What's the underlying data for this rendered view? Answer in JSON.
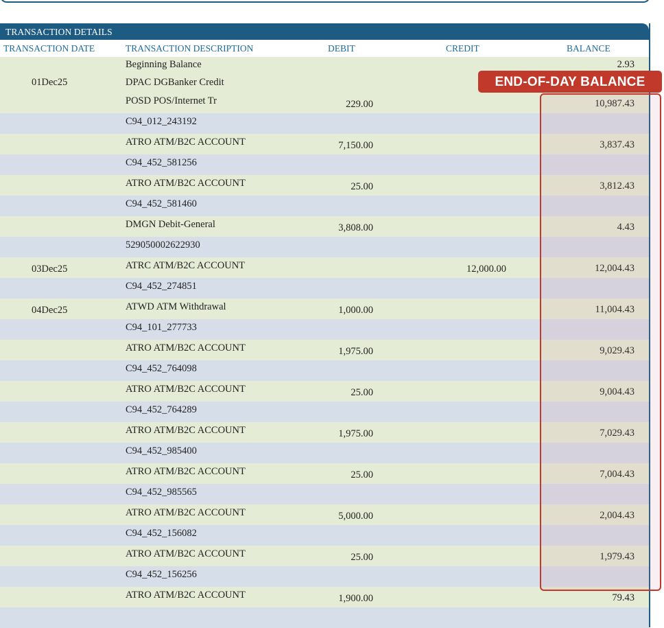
{
  "section_title": "TRANSACTION DETAILS",
  "columns": {
    "date": "TRANSACTION DATE",
    "description": "TRANSACTION DESCRIPTION",
    "debit": "DEBIT",
    "credit": "CREDIT",
    "balance": "BALANCE"
  },
  "annotation": {
    "label": "END-OF-DAY BALANCE",
    "color": "#c0392b"
  },
  "colors": {
    "header_bg": "#1d5b82",
    "heading_text": "#1e6a9c",
    "row_green": "#e4ecd6",
    "row_blue": "#d6dfe9"
  },
  "rows": [
    {
      "date": "",
      "description": "Beginning Balance",
      "debit": "",
      "credit": "",
      "balance": "2.93"
    },
    {
      "date": "01Dec25",
      "description": "DPAC DGBanker Credit",
      "debit": "",
      "credit": "",
      "balance": ""
    },
    {
      "date": "",
      "description": "POSD POS/Internet Tr",
      "debit": "229.00",
      "credit": "",
      "balance": "10,987.43"
    },
    {
      "date": "",
      "description": "C94_012_243192",
      "debit": "",
      "credit": "",
      "balance": ""
    },
    {
      "date": "",
      "description": "ATRO ATM/B2C ACCOUNT",
      "debit": "7,150.00",
      "credit": "",
      "balance": "3,837.43"
    },
    {
      "date": "",
      "description": "C94_452_581256",
      "debit": "",
      "credit": "",
      "balance": ""
    },
    {
      "date": "",
      "description": "ATRO ATM/B2C ACCOUNT",
      "debit": "25.00",
      "credit": "",
      "balance": "3,812.43"
    },
    {
      "date": "",
      "description": "C94_452_581460",
      "debit": "",
      "credit": "",
      "balance": ""
    },
    {
      "date": "",
      "description": "DMGN Debit-General",
      "debit": "3,808.00",
      "credit": "",
      "balance": "4.43"
    },
    {
      "date": "",
      "description": "529050002622930",
      "debit": "",
      "credit": "",
      "balance": ""
    },
    {
      "date": "03Dec25",
      "description": "ATRC ATM/B2C ACCOUNT",
      "debit": "",
      "credit": "12,000.00",
      "balance": "12,004.43"
    },
    {
      "date": "",
      "description": "C94_452_274851",
      "debit": "",
      "credit": "",
      "balance": ""
    },
    {
      "date": "04Dec25",
      "description": "ATWD ATM Withdrawal",
      "debit": "1,000.00",
      "credit": "",
      "balance": "11,004.43"
    },
    {
      "date": "",
      "description": "C94_101_277733",
      "debit": "",
      "credit": "",
      "balance": ""
    },
    {
      "date": "",
      "description": "ATRO ATM/B2C ACCOUNT",
      "debit": "1,975.00",
      "credit": "",
      "balance": "9,029.43"
    },
    {
      "date": "",
      "description": "C94_452_764098",
      "debit": "",
      "credit": "",
      "balance": ""
    },
    {
      "date": "",
      "description": "ATRO ATM/B2C ACCOUNT",
      "debit": "25.00",
      "credit": "",
      "balance": "9,004.43"
    },
    {
      "date": "",
      "description": "C94_452_764289",
      "debit": "",
      "credit": "",
      "balance": ""
    },
    {
      "date": "",
      "description": "ATRO ATM/B2C ACCOUNT",
      "debit": "1,975.00",
      "credit": "",
      "balance": "7,029.43"
    },
    {
      "date": "",
      "description": "C94_452_985400",
      "debit": "",
      "credit": "",
      "balance": ""
    },
    {
      "date": "",
      "description": "ATRO ATM/B2C ACCOUNT",
      "debit": "25.00",
      "credit": "",
      "balance": "7,004.43"
    },
    {
      "date": "",
      "description": "C94_452_985565",
      "debit": "",
      "credit": "",
      "balance": ""
    },
    {
      "date": "",
      "description": "ATRO ATM/B2C ACCOUNT",
      "debit": "5,000.00",
      "credit": "",
      "balance": "2,004.43"
    },
    {
      "date": "",
      "description": "C94_452_156082",
      "debit": "",
      "credit": "",
      "balance": ""
    },
    {
      "date": "",
      "description": "ATRO ATM/B2C ACCOUNT",
      "debit": "25.00",
      "credit": "",
      "balance": "1,979.43"
    },
    {
      "date": "",
      "description": "C94_452_156256",
      "debit": "",
      "credit": "",
      "balance": ""
    },
    {
      "date": "",
      "description": "ATRO ATM/B2C ACCOUNT",
      "debit": "1,900.00",
      "credit": "",
      "balance": "79.43"
    },
    {
      "date": "",
      "description": "",
      "debit": "",
      "credit": "",
      "balance": ""
    }
  ]
}
